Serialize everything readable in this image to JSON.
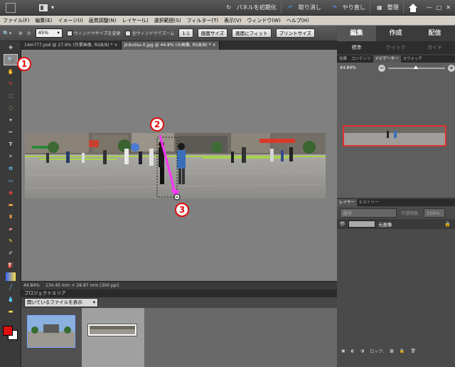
{
  "topbar": {
    "panel_reset": "パネルを初期化",
    "undo": "取り消し",
    "redo": "やり直し",
    "organize": "整理"
  },
  "menu": [
    "ファイル(F)",
    "編集(E)",
    "イメージ(I)",
    "画質調整(N)",
    "レイヤー(L)",
    "選択範囲(S)",
    "フィルター(T)",
    "表示(V)",
    "ウィンドウ(W)",
    "ヘルプ(H)"
  ],
  "options": {
    "zoom_value": "45%",
    "resize_windows": "ウィンドウサイズを変更",
    "all_windows_zoom": "全ウィンドウでズーム",
    "one_to_one": "1:1",
    "screen_size": "画面サイズ",
    "fit_screen": "画面にフィット",
    "print_size": "プリントサイズ"
  },
  "doc_tabs": [
    {
      "label": "14m777.psd @ 27.8% (作業画像, RGB/8) *"
    },
    {
      "label": "jinbutsu-0.jpg @ 44.8% (元画像, RGB/8) *"
    }
  ],
  "status": {
    "zoom": "44.84%",
    "dimensions": "134.45 mm × 28.87 mm (300 ppi)"
  },
  "project": {
    "title": "プロジェクトエリア",
    "dropdown": "開いているファイルを表示"
  },
  "right": {
    "tabs": [
      "編集",
      "作成",
      "配信"
    ],
    "subtabs": [
      "標準",
      "クイック",
      "ガイド"
    ],
    "nav_tabs": [
      "効果",
      "コンテンツ",
      "ナビゲーター",
      "スウォッチ"
    ],
    "nav_zoom": "44.84%",
    "layer_tabs": [
      "レイヤー",
      "ヒストリー"
    ],
    "blend_mode": "通常",
    "opacity_label": "不透明度:",
    "opacity_value": "100%",
    "layer_name": "元画像",
    "lock_label": "ロック:"
  },
  "annotations": [
    "1",
    "2",
    "3"
  ],
  "colors": {
    "accent": "#e01010",
    "selection": "#ff33ff"
  }
}
